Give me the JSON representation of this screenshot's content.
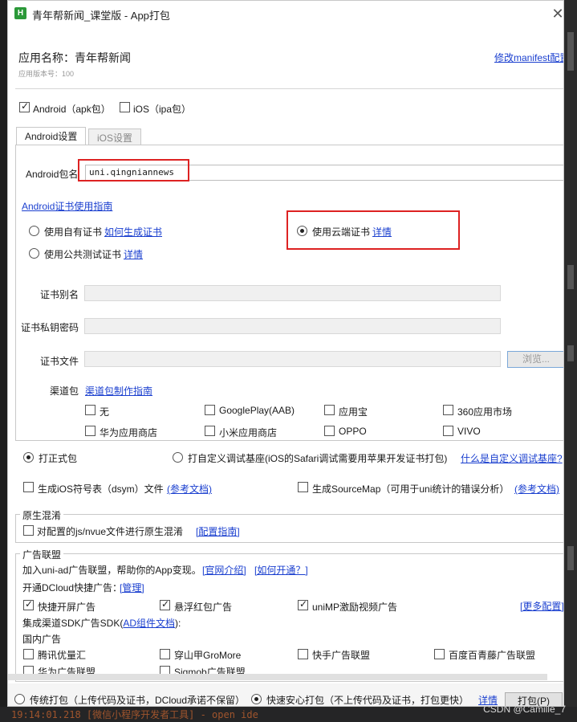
{
  "window": {
    "title": "青年帮新闻_课堂版 - App打包",
    "icon_letter": "H"
  },
  "header": {
    "app_name": "应用名称：青年帮新闻",
    "app_version": "应用版本号：100",
    "manifest_link": "修改manifest配置"
  },
  "platforms": {
    "android_label": "Android（apk包）",
    "android_checked": true,
    "ios_label": "iOS（ipa包）",
    "ios_checked": false
  },
  "tabs": {
    "android": "Android设置",
    "ios": "iOS设置"
  },
  "android": {
    "package_label": "Android包名",
    "package_value": "uni.qingniannews",
    "cert_guide_link": "Android证书使用指南",
    "own_cert_label": "使用自有证书",
    "own_cert_link": "如何生成证书",
    "public_cert_label": "使用公共测试证书",
    "public_cert_link": "详情",
    "cloud_cert_label": "使用云端证书",
    "cloud_cert_link": "详情",
    "alias_label": "证书别名",
    "password_label": "证书私钥密码",
    "file_label": "证书文件",
    "browse_label": "浏览...",
    "channel_label": "渠道包",
    "channel_link": "渠道包制作指南",
    "channels": {
      "none": "无",
      "googleplay": "GooglePlay(AAB)",
      "yingyongbao": "应用宝",
      "c360": "360应用市场",
      "huawei": "华为应用商店",
      "xiaomi": "小米应用商店",
      "oppo": "OPPO",
      "vivo": "VIVO"
    }
  },
  "build_mode": {
    "formal_label": "打正式包",
    "custom_base_label": "打自定义调试基座(iOS的Safari调试需要用苹果开发证书打包)",
    "custom_base_link": "什么是自定义调试基座?"
  },
  "options": {
    "dsym_label": "生成iOS符号表（dsym）文件",
    "dsym_link": "(参考文档)",
    "sourcemap_label": "生成SourceMap（可用于uni统计的错误分析）",
    "sourcemap_link": "(参考文档)"
  },
  "obfuscation": {
    "title": "原生混淆",
    "checkbox_label": "对配置的js/nvue文件进行原生混淆",
    "guide_link": "[配置指南]"
  },
  "ads": {
    "title": "广告联盟",
    "intro": "加入uni-ad广告联盟，帮助你的App变现。",
    "official_link": "[官网介绍]",
    "how_link": "[如何开通？]",
    "dcloud_label": "开通DCloud快捷广告：",
    "manage_link": "[管理]",
    "splash": "快捷开屏广告",
    "redpacket": "悬浮红包广告",
    "rewarded": "uniMP激励视频广告",
    "more_link": "[更多配置]",
    "sdk_label": "集成渠道SDK广告SDK(",
    "sdk_link": "AD组件文档",
    "sdk_label_end": "):",
    "domestic_label": "国内广告",
    "tencent": "腾讯优量汇",
    "csj": "穿山甲GroMore",
    "kuaishou": "快手广告联盟",
    "baidu": "百度百青藤广告联盟",
    "huawei": "华为广告联盟",
    "sigmob": "Sigmob广告联盟"
  },
  "footer": {
    "traditional_label": "传统打包（上传代码及证书，DCloud承诺不保留）",
    "safe_label": "快速安心打包（不上传代码及证书，打包更快）",
    "details_link": "详情",
    "pack_button": "打包(P)"
  },
  "background": {
    "console_text": "19:14:01.218 [微信小程序开发者工具] - open ide",
    "watermark": "CSDN @Camille_7"
  }
}
